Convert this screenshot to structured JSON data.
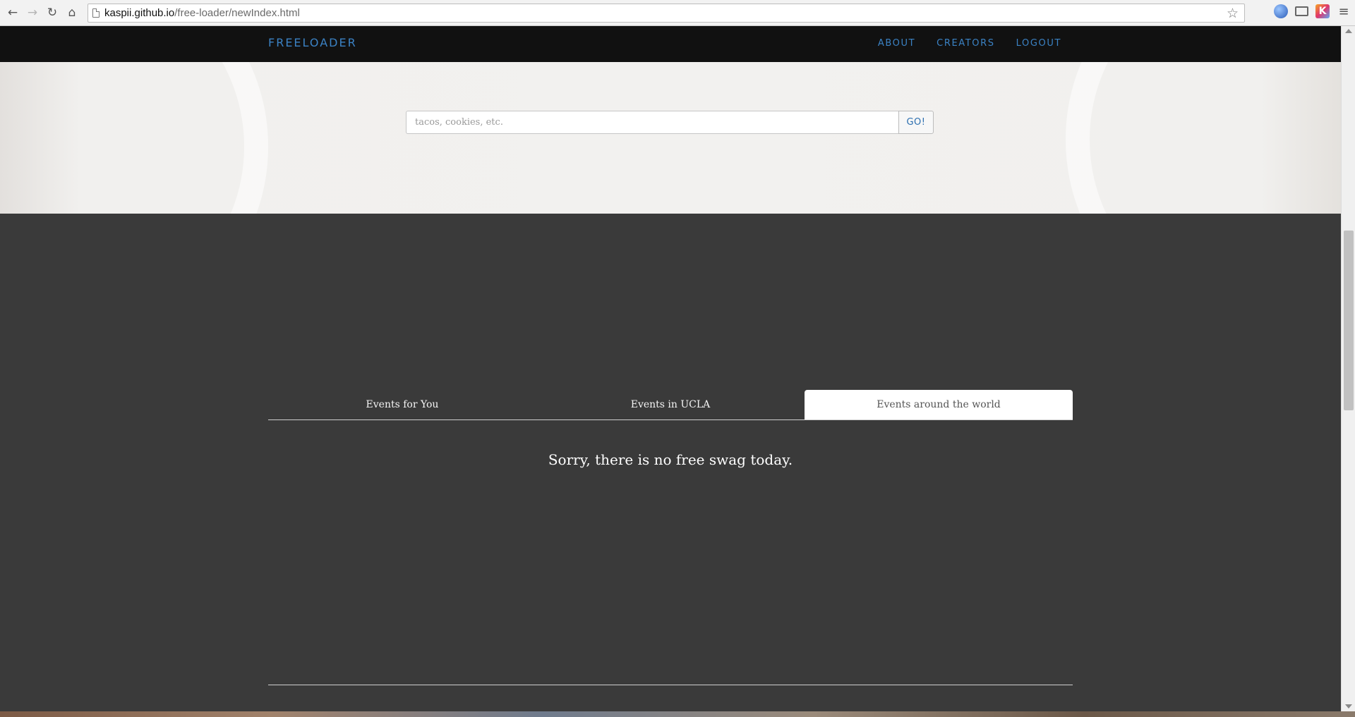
{
  "browser": {
    "url_host": "kaspii.github.io",
    "url_path": "/free-loader/newIndex.html",
    "back_icon": "←",
    "forward_icon": "→",
    "reload_icon": "↻",
    "home_icon": "⌂",
    "star_icon": "☆",
    "menu_icon": "≡"
  },
  "nav": {
    "brand": "FREELOADER",
    "links": [
      "ABOUT",
      "CREATORS",
      "LOGOUT"
    ],
    "accent_color": "#3b82c4"
  },
  "search": {
    "placeholder": "tacos, cookies, etc.",
    "value": "",
    "button_label": "GO!"
  },
  "tabs": [
    {
      "label": "Events for You",
      "active": false
    },
    {
      "label": "Events in UCLA",
      "active": false
    },
    {
      "label": "Events around the world",
      "active": true
    }
  ],
  "empty_message": "Sorry, there is no free swag today."
}
